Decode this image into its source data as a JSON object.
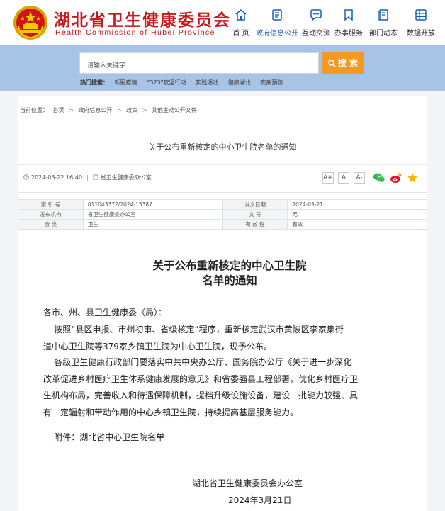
{
  "site": {
    "name_cn": "湖北省卫生健康委员会",
    "name_en": "Health Commission of Hubei Province"
  },
  "nav": [
    {
      "label": "首  页",
      "icon": "home-icon",
      "active": false
    },
    {
      "label": "政府信息公开",
      "icon": "document-list-icon",
      "active": true
    },
    {
      "label": "互动交流",
      "icon": "chat-icon",
      "active": false
    },
    {
      "label": "办事服务",
      "icon": "bookmark-icon",
      "active": false
    },
    {
      "label": "部门动态",
      "icon": "news-icon",
      "active": false
    },
    {
      "label": "数据开放",
      "icon": "data-grid-icon",
      "active": false
    }
  ],
  "search": {
    "placeholder": "请输入关键字",
    "button_label": "搜 索",
    "hot_label": "热门搜索：",
    "hot_terms": [
      "新冠疫情",
      "“323”攻坚行动",
      "实践活动",
      "健康湖北",
      "疾病预防"
    ]
  },
  "breadcrumb": {
    "prefix": "当前位置：",
    "items": [
      "首页",
      "政府信息公开",
      "政策",
      "其他主动公开文件"
    ],
    "sep": ">"
  },
  "doc": {
    "title": "关于公布重新核定的中心卫生院名单的通知",
    "datetime": "2024-03-22 16:40",
    "source": "省卫生健康委办公室",
    "font_sizes": [
      "A+",
      "A",
      "A-"
    ]
  },
  "info_table": [
    [
      {
        "k": "索 引 号",
        "v": "011043372/2024-15387"
      },
      {
        "k": "发文日期",
        "v": "2024-03-21"
      }
    ],
    [
      {
        "k": "发布机构",
        "v": "省卫生健康委办公室"
      },
      {
        "k": "文    号",
        "v": "无"
      }
    ],
    [
      {
        "k": "分    类",
        "v": "卫生"
      },
      {
        "k": "有 效 性",
        "v": "有效"
      }
    ]
  ],
  "article": {
    "heading_lines": [
      "关于公布重新核定的中心卫生院",
      "名单的通知"
    ],
    "salutation": "各市、州、县卫生健康委（局）：",
    "para1_lines": [
      "    按照“县区申报、市州初审、省级核定”程序，重新核定武汉市黄陂区李家集街",
      "道中心卫生院等379家乡镇卫生院为中心卫生院，现予公布。"
    ],
    "para2_lines": [
      "    各级卫生健康行政部门要落实中共中央办公厅、国务院办公厅《关于进一步深化",
      "改革促进乡村医疗卫生体系健康发展的意见》和省委强县工程部署，优化乡村医疗卫",
      "生机构布局，完善收入和待遇保障机制，提档升级设施设备，建设一批能力较强、具",
      "有一定辐射和带动作用的中心乡镇卫生院，持续提高基层服务能力。"
    ],
    "attachment": "    附件：湖北省中心卫生院名单",
    "signature": "湖北省卫生健康委员会办公室",
    "date": "2024年3月21日"
  },
  "colors": {
    "brand_red": "#c8171d",
    "nav_active": "#1a5fb4",
    "search_band": "#a7c3e6",
    "search_button": "#f29a24"
  }
}
